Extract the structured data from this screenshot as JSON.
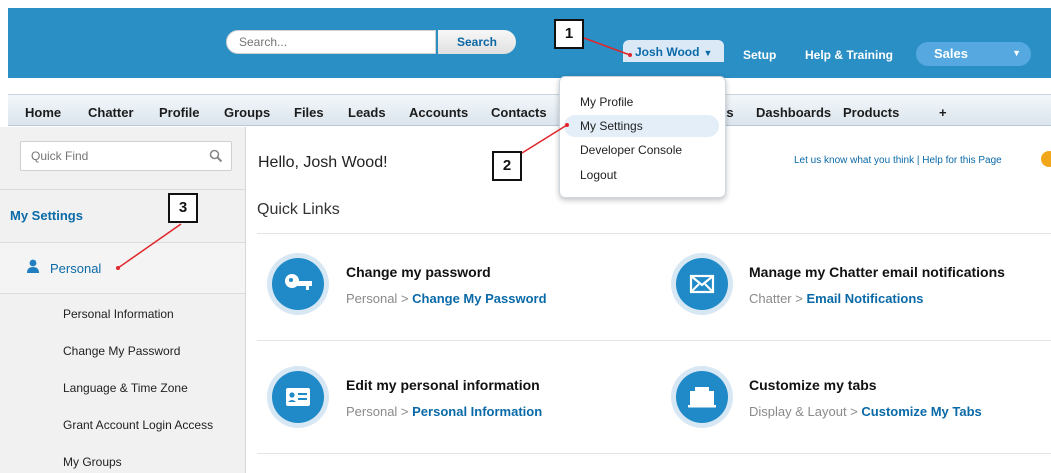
{
  "header": {
    "search_placeholder": "Search...",
    "search_button": "Search",
    "user_name": "Josh Wood",
    "setup": "Setup",
    "help_training": "Help & Training",
    "app_name": "Sales"
  },
  "user_menu": {
    "items": [
      "My Profile",
      "My Settings",
      "Developer Console",
      "Logout"
    ]
  },
  "tabs": [
    "Home",
    "Chatter",
    "Profile",
    "Groups",
    "Files",
    "Leads",
    "Accounts",
    "Contacts",
    "ts",
    "Dashboards",
    "Products",
    "+"
  ],
  "sidebar": {
    "quick_find_placeholder": "Quick Find",
    "title": "My Settings",
    "section": "Personal",
    "sub_items": [
      "Personal Information",
      "Change My Password",
      "Language & Time Zone",
      "Grant Account Login Access",
      "My Groups"
    ]
  },
  "main": {
    "greeting": "Hello, Josh Wood!",
    "feedback": "Let us know what you think | Help for this Page",
    "quick_links_title": "Quick Links",
    "cards": [
      {
        "title": "Change my password",
        "path": "Personal >",
        "link": "Change My Password",
        "icon": "key-icon"
      },
      {
        "title": "Manage my Chatter email notifications",
        "path": "Chatter >",
        "link": "Email Notifications",
        "icon": "envelope-icon"
      },
      {
        "title": "Edit my personal information",
        "path": "Personal >",
        "link": "Personal Information",
        "icon": "id-card-icon"
      },
      {
        "title": "Customize my tabs",
        "path": "Display & Layout >",
        "link": "Customize My Tabs",
        "icon": "tabs-icon"
      }
    ]
  },
  "callouts": [
    "1",
    "2",
    "3"
  ],
  "colors": {
    "header_blue": "#2a8fc5",
    "link_blue": "#0a6aa8",
    "callout_arrow": "#e0262b",
    "icon_circle": "#1f8ac7"
  }
}
